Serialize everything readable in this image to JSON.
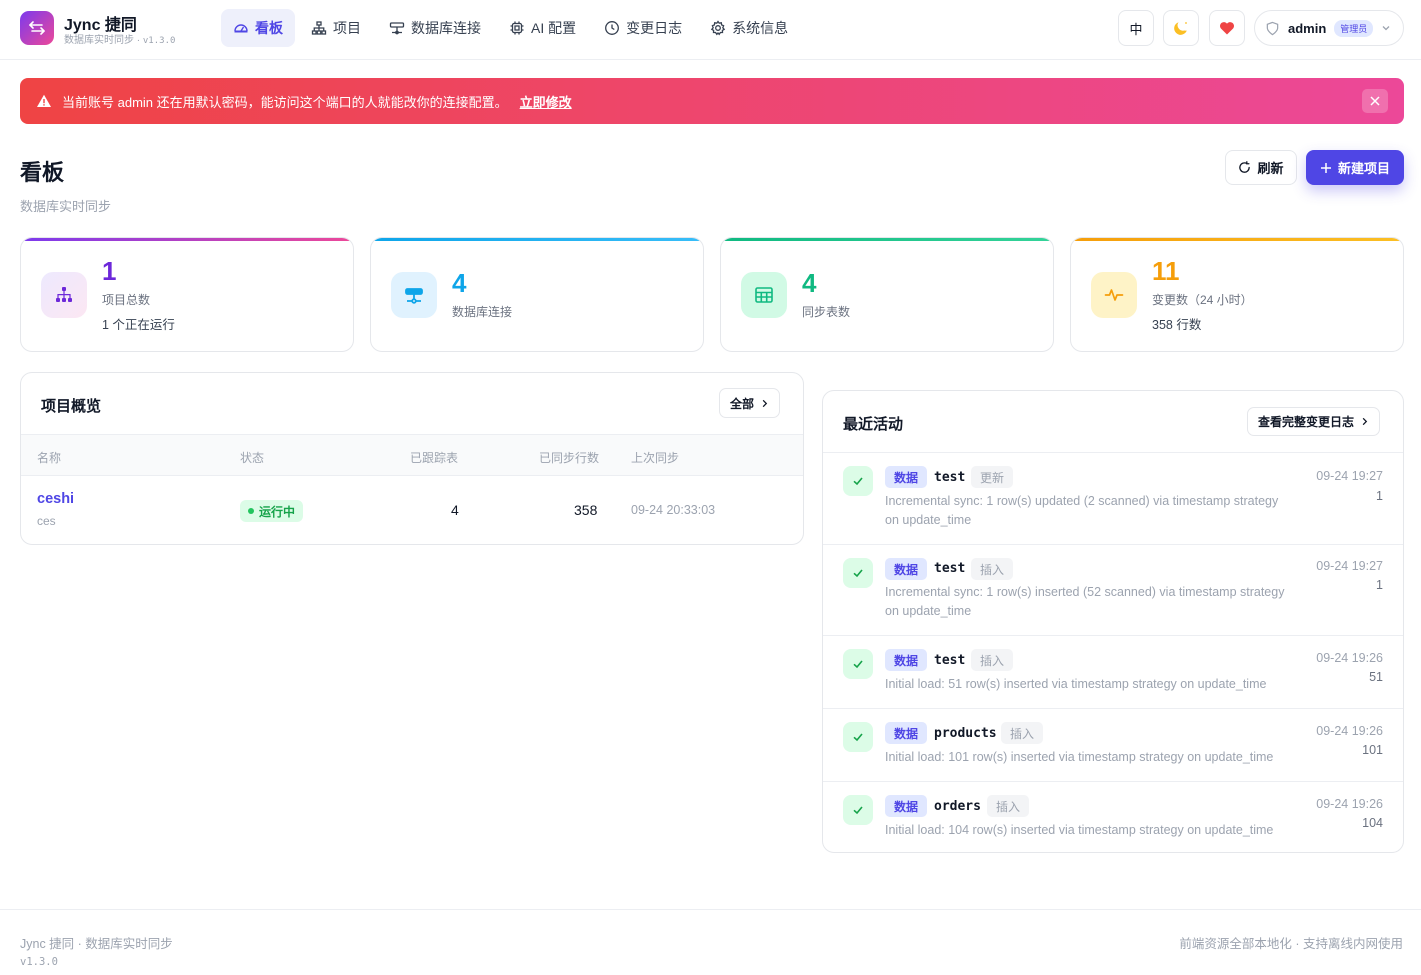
{
  "header": {
    "brand_name": "Jync 捷同",
    "brand_sub": "数据库实时同步",
    "version": "v1.3.0",
    "nav": [
      {
        "label": "看板",
        "icon": "gauge-icon",
        "active": true
      },
      {
        "label": "项目",
        "icon": "sitemap-icon",
        "active": false
      },
      {
        "label": "数据库连接",
        "icon": "server-icon",
        "active": false
      },
      {
        "label": "AI 配置",
        "icon": "chip-icon",
        "active": false
      },
      {
        "label": "变更日志",
        "icon": "clock-icon",
        "active": false
      },
      {
        "label": "系统信息",
        "icon": "gear-icon",
        "active": false
      }
    ],
    "lang_label": "中",
    "user": {
      "name": "admin",
      "role": "管理员"
    }
  },
  "alert": {
    "message": "当前账号 admin 还在用默认密码，能访问这个端口的人就能改你的连接配置。",
    "link": "立即修改"
  },
  "page": {
    "title": "看板",
    "subtitle": "数据库实时同步",
    "refresh_label": "刷新",
    "new_project_label": "新建项目"
  },
  "stats": [
    {
      "value": "1",
      "label": "项目总数",
      "extra": "1 个正在运行",
      "color": "#6d28d9"
    },
    {
      "value": "4",
      "label": "数据库连接",
      "extra": "",
      "color": "#0ea5e9"
    },
    {
      "value": "4",
      "label": "同步表数",
      "extra": "",
      "color": "#10b981"
    },
    {
      "value": "11",
      "label": "变更数（24 小时）",
      "extra": "358 行数",
      "color": "#f59e0b"
    }
  ],
  "projects": {
    "title": "项目概览",
    "all_label": "全部",
    "columns": [
      "名称",
      "状态",
      "已跟踪表",
      "已同步行数",
      "上次同步"
    ],
    "rows": [
      {
        "name": "ceshi",
        "desc": "ces",
        "status": "运行中",
        "tables": "4",
        "rows": "358",
        "last_sync": "09-24 20:33:03"
      }
    ]
  },
  "activity": {
    "title": "最近活动",
    "view_all_label": "查看完整变更日志",
    "items": [
      {
        "tag": "数据",
        "table": "test",
        "op": "更新",
        "desc": "Incremental sync: 1 row(s) updated (2 scanned) via timestamp strategy on update_time",
        "time": "09-24 19:27",
        "count": "1"
      },
      {
        "tag": "数据",
        "table": "test",
        "op": "插入",
        "desc": "Incremental sync: 1 row(s) inserted (52 scanned) via timestamp strategy on update_time",
        "time": "09-24 19:27",
        "count": "1"
      },
      {
        "tag": "数据",
        "table": "test",
        "op": "插入",
        "desc": "Initial load: 51 row(s) inserted via timestamp strategy on update_time",
        "time": "09-24 19:26",
        "count": "51"
      },
      {
        "tag": "数据",
        "table": "products",
        "op": "插入",
        "desc": "Initial load: 101 row(s) inserted via timestamp strategy on update_time",
        "time": "09-24 19:26",
        "count": "101"
      },
      {
        "tag": "数据",
        "table": "orders",
        "op": "插入",
        "desc": "Initial load: 104 row(s) inserted via timestamp strategy on update_time",
        "time": "09-24 19:26",
        "count": "104"
      }
    ]
  },
  "footer": {
    "left": "Jync 捷同 · 数据库实时同步",
    "version": "v1.3.0",
    "right": "前端资源全部本地化 · 支持离线内网使用"
  }
}
